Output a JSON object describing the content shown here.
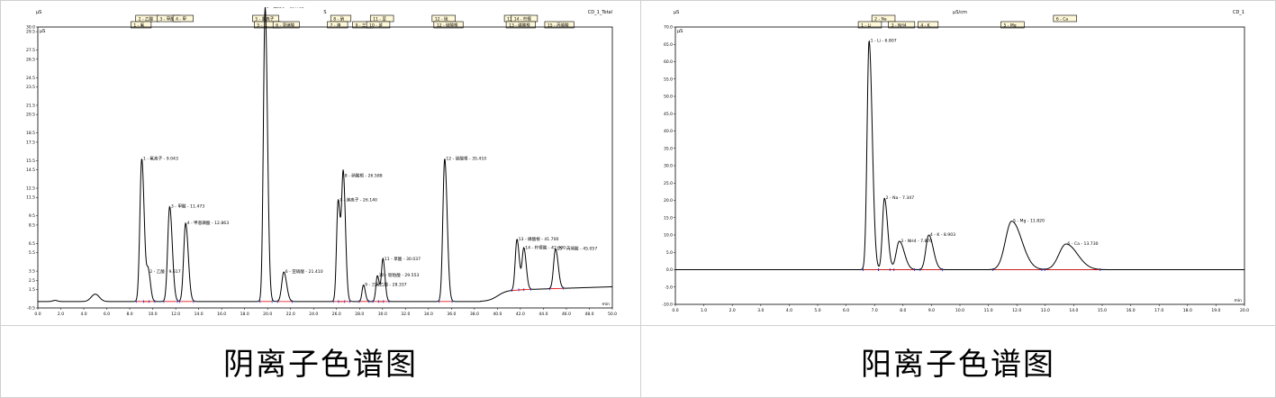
{
  "captions": {
    "anion": "阴离子色谱图",
    "cation": "阳离子色谱图"
  },
  "colors": {
    "trace": "#000000",
    "baseline": "#e00000",
    "marker": "#1a2fd0",
    "peak_box_fill": "#fff8d8"
  },
  "chart_data": [
    {
      "type": "line",
      "title": "",
      "header_left": "µS",
      "header_mid": "S",
      "header_right": "CD_1_Total",
      "ylabel": "µS",
      "xlabel": "min",
      "xlim": [
        0,
        50
      ],
      "ylim": [
        -0.5,
        30
      ],
      "x_ticks": [
        0,
        2,
        4,
        6,
        8,
        10,
        12,
        14,
        16,
        18,
        20,
        22,
        24,
        26,
        28,
        30,
        32,
        34,
        36,
        38,
        40,
        42,
        44,
        46,
        48,
        50
      ],
      "y_ticks": [
        -0.5,
        1.5,
        2.5,
        3.5,
        5.5,
        6.5,
        8.5,
        9.5,
        11.5,
        12.5,
        14.5,
        15.5,
        17.5,
        18.5,
        20.5,
        21.5,
        23.5,
        24.5,
        26.5,
        27.5,
        29.5,
        30.0
      ],
      "baseline_level": 0.2,
      "peaks": [
        {
          "n": 1,
          "name": "氟离子",
          "rt": 9.043,
          "height": 15.5,
          "width": 0.16,
          "label": "1 - 氟离子 - 9.043"
        },
        {
          "n": 2,
          "name": "乙酸",
          "rt": 9.617,
          "height": 3.2,
          "width": 0.14,
          "label": "2 - 乙酸 - 9.617"
        },
        {
          "n": 3,
          "name": "甲酸",
          "rt": 11.473,
          "height": 10.3,
          "width": 0.17,
          "label": "3 - 甲酸 - 11.473"
        },
        {
          "n": 4,
          "name": "甲基磺酸",
          "rt": 12.863,
          "height": 8.5,
          "width": 0.17,
          "label": "4 - 甲基磺酸 - 12.863"
        },
        {
          "n": 5,
          "name": "氯离子",
          "rt": 19.783,
          "height": 32.0,
          "width": 0.15,
          "label": "5 - 氯离子 - 19.783"
        },
        {
          "n": 6,
          "name": "亚硝酸",
          "rt": 21.41,
          "height": 3.2,
          "width": 0.18,
          "label": "6 - 亚硝酸 - 21.410"
        },
        {
          "n": 7,
          "name": "溴离子",
          "rt": 26.14,
          "height": 11.0,
          "width": 0.14,
          "label": "7 - 溴离子 - 26.140"
        },
        {
          "n": 8,
          "name": "硝酸根",
          "rt": 26.588,
          "height": 13.6,
          "width": 0.14,
          "label": "8 - 硝酸根 - 26.588"
        },
        {
          "n": 9,
          "name": "三氟乙酸",
          "rt": 28.337,
          "height": 1.8,
          "width": 0.12,
          "label": "9 - 三氟乙酸 - 28.337"
        },
        {
          "n": 10,
          "name": "琥珀酸",
          "rt": 29.553,
          "height": 2.8,
          "width": 0.13,
          "label": "10 - 琥珀酸 - 29.553"
        },
        {
          "n": 11,
          "name": "草酸",
          "rt": 30.037,
          "height": 4.6,
          "width": 0.13,
          "label": "11 - 草酸 - 30.037"
        },
        {
          "n": 12,
          "name": "硫酸根",
          "rt": 35.41,
          "height": 15.5,
          "width": 0.16,
          "label": "12 - 硫酸根 - 35.410"
        },
        {
          "n": 13,
          "name": "磷酸根",
          "rt": 41.7,
          "height": 5.5,
          "width": 0.15,
          "label": "13 - 磷酸根 - 41.700"
        },
        {
          "n": 14,
          "name": "柠檬酸",
          "rt": 42.3,
          "height": 4.5,
          "width": 0.15,
          "label": "14 - 柠檬酸 - 42.300"
        },
        {
          "n": 15,
          "name": "丙烯酸",
          "rt": 45.057,
          "height": 4.3,
          "width": 0.17,
          "label": "15 - 丙烯酸 - 45.057"
        }
      ],
      "peak_boxes_top": [
        "2 - 乙酸",
        "3 - 甲酸",
        "4 - 甲",
        "5 - 氯离子",
        "8 - 硝",
        "11 - 草",
        "12 - 硫",
        "13 - 磷酸",
        "14 - 柠檬"
      ],
      "peak_boxes_bottom": [
        "1 - 氟",
        "5 - ...",
        "6 - 亚硝酸",
        "7 - 溴",
        "9 - 三",
        "10 - 琥",
        "12 - 硫酸根",
        "13 - 磷酸根",
        "15 - 丙烯酸"
      ]
    },
    {
      "type": "line",
      "title": "",
      "header_left": "µS",
      "header_mid": "µS/cm",
      "header_right": "CD_1",
      "ylabel": "µS",
      "xlabel": "min",
      "xlim": [
        0,
        20
      ],
      "ylim": [
        -10,
        70
      ],
      "x_ticks": [
        0,
        1,
        2,
        3,
        4,
        5,
        6,
        7,
        8,
        9,
        10,
        11,
        12,
        13,
        14,
        15,
        16,
        17,
        18,
        19,
        20
      ],
      "y_ticks": [
        -10,
        -5,
        0,
        5,
        10,
        15,
        20,
        25,
        30,
        35,
        40,
        45,
        50,
        55,
        60,
        65,
        70
      ],
      "baseline_level": 0,
      "peaks": [
        {
          "n": 1,
          "name": "Li",
          "rt": 6.807,
          "height": 66.0,
          "width": 0.07,
          "label": "1 - Li - 6.807"
        },
        {
          "n": 2,
          "name": "Na",
          "rt": 7.347,
          "height": 20.6,
          "width": 0.07,
          "label": "2 - Na - 7.347"
        },
        {
          "n": 3,
          "name": "NH4",
          "rt": 7.87,
          "height": 8.2,
          "width": 0.11,
          "label": "3 - NH4 - 7.870"
        },
        {
          "n": 4,
          "name": "K",
          "rt": 8.903,
          "height": 10.0,
          "width": 0.1,
          "label": "4 - K - 8.903"
        },
        {
          "n": 5,
          "name": "Mg",
          "rt": 11.82,
          "height": 14.0,
          "width": 0.22,
          "label": "5 - Mg - 11.820"
        },
        {
          "n": 6,
          "name": "Ca",
          "rt": 13.73,
          "height": 7.4,
          "width": 0.25,
          "label": "6 - Ca - 13.730"
        }
      ],
      "peak_boxes_top": [
        "2 - Na",
        "6 - Ca"
      ],
      "peak_boxes_bottom": [
        "1 - Li",
        "3 - NH4",
        "4 - K",
        "5 - Mg"
      ]
    }
  ]
}
